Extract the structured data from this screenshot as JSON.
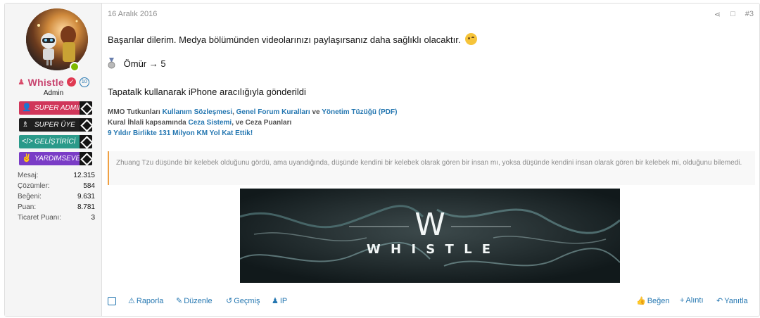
{
  "user": {
    "username": "Whistle",
    "level_badge": "10",
    "title": "Admin",
    "banners": [
      "SUPER ADMIN",
      "SUPER ÜYE",
      "GELİŞTİRİCİ",
      "YARDIMSEVER"
    ],
    "stats": [
      {
        "label": "Mesaj:",
        "value": "12.315"
      },
      {
        "label": "Çözümler:",
        "value": "584"
      },
      {
        "label": "Beğeni:",
        "value": "9.631"
      },
      {
        "label": "Puan:",
        "value": "8.781"
      },
      {
        "label": "Ticaret Puanı:",
        "value": "3"
      }
    ]
  },
  "post": {
    "date": "16 Aralık 2016",
    "number": "#3",
    "line1": "Başarılar dilerim. Medya bölümünden videolarınızı paylaşırsanız daha sağlıklı olacaktır.",
    "line2": "Ömür → 5",
    "line3": "Tapatalk kullanarak iPhone aracılığıyla gönderildi"
  },
  "signature": {
    "row1_prefix": "MMO Tutkunları",
    "row1_link1": "Kullanım Sözleşmesi",
    "row1_sep": ",",
    "row1_link2": "Genel Forum Kuralları",
    "row1_ve": "ve",
    "row1_link3": "Yönetim Tüzüğü",
    "row1_link4": "(PDF)",
    "row2_prefix": "Kural İhlali kapsamında",
    "row2_link": "Ceza Sistemi",
    "row2_suffix": ", ve Ceza Puanları",
    "row3_link": "9 Yıldır Birlikte 131 Milyon KM Yol Kat Ettik!",
    "quote": "Zhuang Tzu düşünde bir kelebek olduğunu gördü, ama uyandığında, düşünde kendini bir kelebek olarak gören bir insan mı, yoksa düşünde kendini insan olarak gören bir kelebek mi, olduğunu bilemedi.",
    "image_letter": "W",
    "image_word": "W H I S T L E"
  },
  "footer": {
    "report": "Raporla",
    "edit": "Düzenle",
    "history": "Geçmiş",
    "ip": "IP",
    "like": "Beğen",
    "quote": "Alıntı",
    "reply": "Yanıtla"
  },
  "colors": {
    "link": "#2577b1",
    "username": "#c8446f",
    "quote_border": "#f0a042"
  }
}
